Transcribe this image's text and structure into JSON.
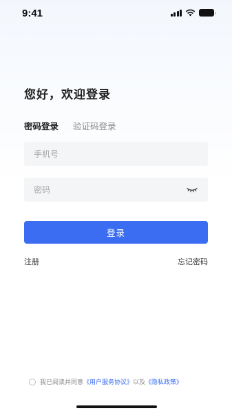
{
  "status_bar": {
    "time": "9:41"
  },
  "greeting": "您好，欢迎登录",
  "tabs": [
    {
      "label": "密码登录",
      "active": true
    },
    {
      "label": "验证码登录",
      "active": false
    }
  ],
  "form": {
    "phone_placeholder": "手机号",
    "password_placeholder": "密码",
    "password_toggle_icon": "eye-closed-icon"
  },
  "login_button": "登录",
  "register_link": "注册",
  "forgot_link": "忘记密码",
  "agreement": {
    "prefix": "我已阅读并同意",
    "terms_link": "《用户服务协议》",
    "middle": "以及",
    "privacy_link": "《隐私政策》"
  },
  "colors": {
    "accent": "#3b6df2",
    "input_bg": "#f4f5f7"
  }
}
